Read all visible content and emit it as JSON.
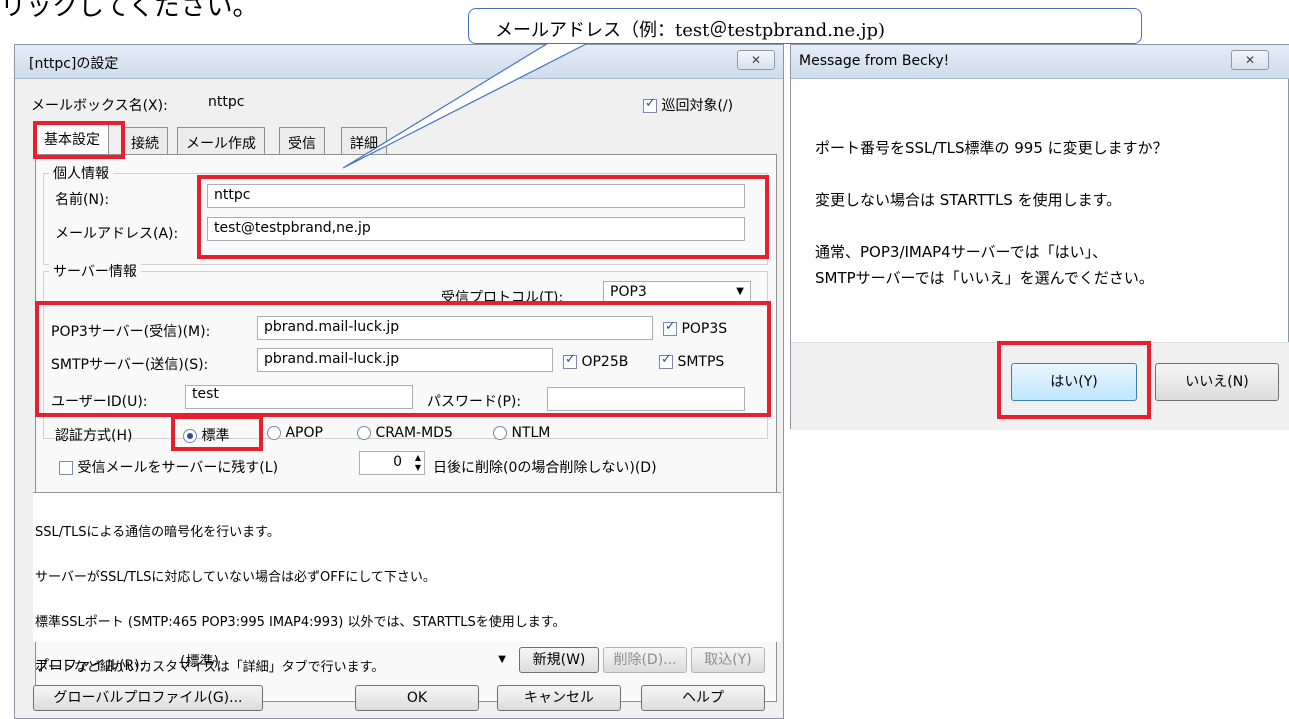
{
  "page_top_text": "リックしてください。",
  "callout": {
    "text": "メールアドレス（例：test＠testpbrand.ne.jp)"
  },
  "settings_dialog": {
    "title": "[nttpc]の設定",
    "close_label": "✕",
    "mailbox_name_label": "メールボックス名(X):",
    "mailbox_name_value": "nttpc",
    "patrol_label": "巡回対象(/)",
    "patrol_checked": true,
    "tabs": [
      {
        "label": "基本設定",
        "active": true
      },
      {
        "label": "接続",
        "active": false
      },
      {
        "label": "メール作成",
        "active": false
      },
      {
        "label": "受信",
        "active": false
      },
      {
        "label": "詳細",
        "active": false
      }
    ],
    "personal_group_title": "個人情報",
    "name_label": "名前(N):",
    "name_value": "nttpc",
    "email_label": "メールアドレス(A):",
    "email_value": "test@testpbrand,ne.jp",
    "server_group_title": "サーバー情報",
    "protocol_label": "受信プロトコル(T):",
    "protocol_value": "POP3",
    "pop3_server_label": "POP3サーバー(受信)(M):",
    "pop3_server_value": "pbrand.mail-luck.jp",
    "pop3s_label": "POP3S",
    "smtp_server_label": "SMTPサーバー(送信)(S):",
    "smtp_server_value": "pbrand.mail-luck.jp",
    "op25b_label": "OP25B",
    "smtps_label": "SMTPS",
    "user_id_label": "ユーザーID(U):",
    "user_id_value": "test",
    "password_label": "パスワード(P):",
    "password_value": "",
    "auth_label": "認証方式(H)",
    "auth_options": [
      "標準",
      "APOP",
      "CRAM-MD5",
      "NTLM"
    ],
    "auth_selected": "標準",
    "leave_on_server_label": "受信メールをサーバーに残す(L)",
    "delete_days_value": "0",
    "delete_days_label": "日後に削除(0の場合削除しない)(D)",
    "description_lines": [
      "SSL/TLSによる通信の暗号化を行います。",
      "サーバーがSSL/TLSに対応していない場合は必ずOFFにして下さい。",
      "標準SSLポート (SMTP:465 POP3:995 IMAP4:993) 以外では、STARTTLSを使用します。",
      "ポートなど細かいカスタマイズは「詳細」タブで行います。"
    ],
    "profile_label": "プロファイル(R):",
    "profile_value": "(標準)",
    "new_button": "新規(W)",
    "delete_button": "削除(D)...",
    "import_button": "取込(Y)",
    "global_profile_button": "グローバルプロファイル(G)...",
    "ok_button": "OK",
    "cancel_button": "キャンセル",
    "help_button": "ヘルプ"
  },
  "message_dialog": {
    "title": "Message from Becky!",
    "close_label": "✕",
    "line1": "ポート番号をSSL/TLS標準の 995 に変更しますか？",
    "line2": "変更しない場合は STARTTLS を使用します。",
    "line3": "通常、POP3/IMAP4サーバーでは「はい」、",
    "line4": "SMTPサーバーでは「いいえ」を選んでください。",
    "yes_button": "はい(Y)",
    "no_button": "いいえ(N)"
  },
  "colors": {
    "highlight": "#e8202e",
    "callout_border": "#4472c4",
    "dialog_bg": "#f0f0f0"
  }
}
